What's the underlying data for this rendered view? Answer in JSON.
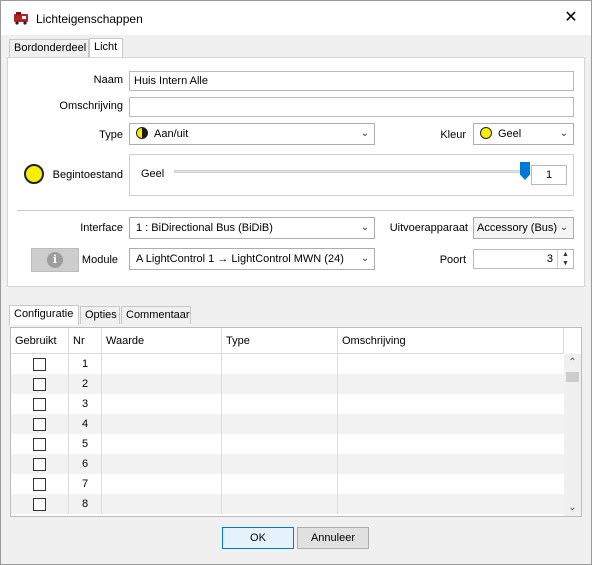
{
  "window": {
    "title": "Lichteigenschappen",
    "close_glyph": "✕"
  },
  "top_tabs": [
    "Bordonderdeel",
    "Licht"
  ],
  "form": {
    "naam_label": "Naam",
    "naam_value": "Huis Intern Alle",
    "omschrijving_label": "Omschrijving",
    "omschrijving_value": "",
    "type_label": "Type",
    "type_value": "Aan/uit",
    "kleur_label": "Kleur",
    "kleur_value": "Geel",
    "begintoestand_label": "Begintoestand",
    "geel_label": "Geel",
    "slider_level": 1.0,
    "geel_value": "1",
    "interface_label": "Interface",
    "interface_value": "1 : BiDirectional Bus (BiDiB)",
    "uitvoer_label": "Uitvoerapparaat",
    "uitvoer_value": "Accessory (Bus)",
    "module_label": "Module",
    "module_value": "A   LightControl 1 → LightControl MWN (24)",
    "poort_label": "Poort",
    "poort_value": "3"
  },
  "bottom_tabs": [
    "Configuratie",
    "Opties",
    "Commentaar"
  ],
  "table": {
    "columns": [
      "Gebruikt",
      "Nr",
      "Waarde",
      "Type",
      "Omschrijving"
    ],
    "rows": [
      "1",
      "2",
      "3",
      "4",
      "5",
      "6",
      "7",
      "8"
    ]
  },
  "buttons": {
    "ok": "OK",
    "cancel": "Annuleer"
  },
  "colors": {
    "accent": "#0078d7",
    "yellow": "#f6f000"
  }
}
